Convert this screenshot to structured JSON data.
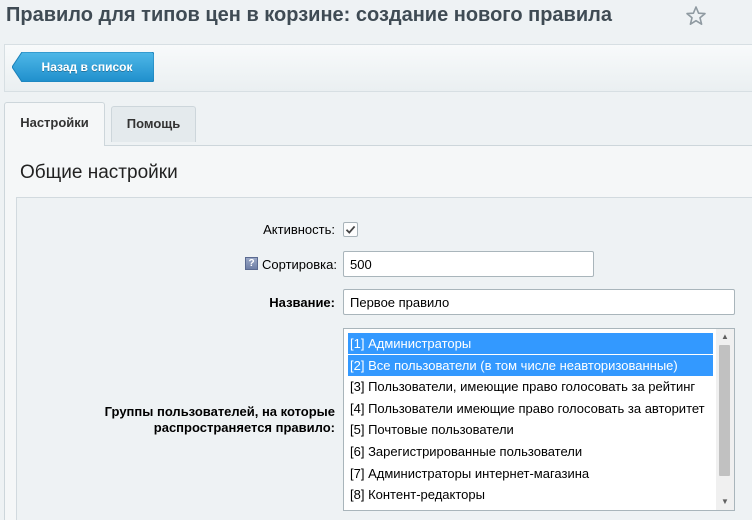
{
  "page": {
    "title": "Правило для типов цен в корзине: создание нового правила"
  },
  "toolbar": {
    "back_label": "Назад в список"
  },
  "tabs": [
    {
      "label": "Настройки",
      "active": true
    },
    {
      "label": "Помощь",
      "active": false
    }
  ],
  "section": {
    "title": "Общие настройки"
  },
  "form": {
    "active": {
      "label": "Активность:",
      "checked": true
    },
    "sort": {
      "label": "Сортировка:",
      "value": "500",
      "help_icon": "help-icon"
    },
    "name": {
      "label": "Название:",
      "value": "Первое правило"
    },
    "groups": {
      "label_line1": "Группы пользователей, на которые",
      "label_line2": "распространяется правило:",
      "options": [
        {
          "label": "[1] Администраторы",
          "selected": true
        },
        {
          "label": "[2] Все пользователи (в том числе неавторизованные)",
          "selected": true
        },
        {
          "label": "[3] Пользователи, имеющие право голосовать за рейтинг",
          "selected": false
        },
        {
          "label": "[4] Пользователи имеющие право голосовать за авторитет",
          "selected": false
        },
        {
          "label": "[5] Почтовые пользователи",
          "selected": false
        },
        {
          "label": "[6] Зарегистрированные пользователи",
          "selected": false
        },
        {
          "label": "[7] Администраторы интернет-магазина",
          "selected": false
        },
        {
          "label": "[8] Контент-редакторы",
          "selected": false
        }
      ]
    }
  },
  "colors": {
    "accent": "#2d9fd8",
    "selection": "#3399ff"
  }
}
